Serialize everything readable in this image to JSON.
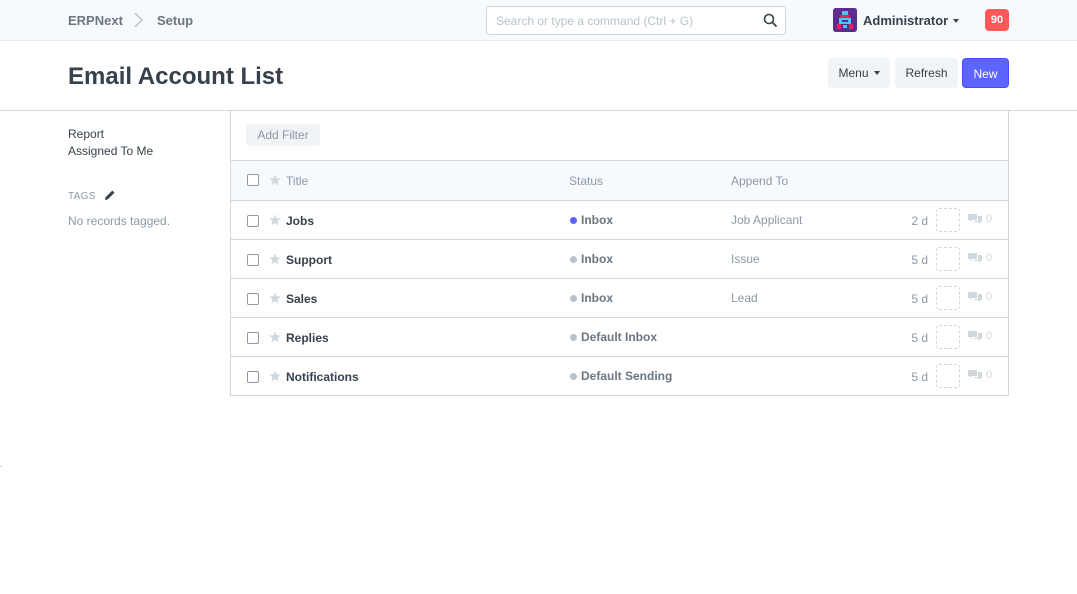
{
  "navbar": {
    "brand": "ERPNext",
    "breadcrumb": "Setup",
    "search_placeholder": "Search or type a command (Ctrl + G)",
    "user": "Administrator",
    "notification_count": "90"
  },
  "page": {
    "title": "Email Account List",
    "menu_label": "Menu",
    "refresh_label": "Refresh",
    "new_label": "New"
  },
  "sidebar": {
    "report": "Report",
    "assigned_to_me": "Assigned To Me",
    "tags_label": "TAGS",
    "no_tags": "No records tagged."
  },
  "list": {
    "add_filter": "Add Filter",
    "columns": {
      "title": "Title",
      "status": "Status",
      "append_to": "Append To"
    },
    "rows": [
      {
        "title": "Jobs",
        "status": "Inbox",
        "status_color": "#5e64ff",
        "append_to": "Job Applicant",
        "modified": "2 d",
        "comments": "0"
      },
      {
        "title": "Support",
        "status": "Inbox",
        "status_color": "#b8c2cc",
        "append_to": "Issue",
        "modified": "5 d",
        "comments": "0"
      },
      {
        "title": "Sales",
        "status": "Inbox",
        "status_color": "#b8c2cc",
        "append_to": "Lead",
        "modified": "5 d",
        "comments": "0"
      },
      {
        "title": "Replies",
        "status": "Default Inbox",
        "status_color": "#b8c2cc",
        "append_to": "",
        "modified": "5 d",
        "comments": "0"
      },
      {
        "title": "Notifications",
        "status": "Default Sending",
        "status_color": "#b8c2cc",
        "append_to": "",
        "modified": "5 d",
        "comments": "0"
      }
    ]
  },
  "colors": {
    "primary": "#5e64ff",
    "danger": "#ff5858",
    "text": "#36414c",
    "muted": "#8d99a6"
  }
}
